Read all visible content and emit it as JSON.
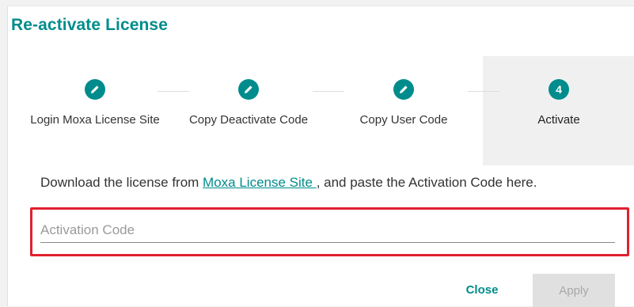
{
  "dialog": {
    "title": "Re-activate License"
  },
  "steps": [
    {
      "label": "Login Moxa License Site",
      "icon": "pencil-icon",
      "state": "completed"
    },
    {
      "label": "Copy Deactivate Code",
      "icon": "pencil-icon",
      "state": "completed"
    },
    {
      "label": "Copy User Code",
      "icon": "pencil-icon",
      "state": "completed"
    },
    {
      "label": "Activate",
      "number": "4",
      "state": "active"
    }
  ],
  "instruction": {
    "prefix": "Download the license from ",
    "link_text": "Moxa License Site ",
    "suffix": ", and paste the Activation Code here."
  },
  "activation_field": {
    "placeholder": "Activation Code",
    "value": ""
  },
  "buttons": {
    "close_label": "Close",
    "apply_label": "Apply"
  },
  "colors": {
    "accent": "#008c8c",
    "highlight": "#e0202e",
    "active_step_bg": "#f0f0f0",
    "disabled_button_bg": "#e0e0e0"
  }
}
